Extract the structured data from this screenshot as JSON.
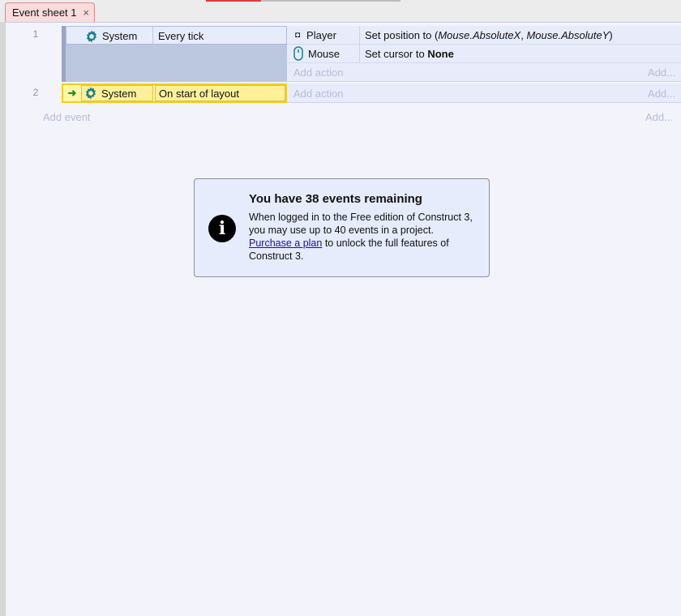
{
  "tabs": [
    {
      "label": "Event sheet 1",
      "close": "×"
    }
  ],
  "events": [
    {
      "number": "1",
      "condition": {
        "object": "System",
        "text": "Every tick"
      },
      "actions": [
        {
          "object": "Player",
          "text_before": "Set position to (",
          "param1": "Mouse.AbsoluteX",
          "sep": ", ",
          "param2": "Mouse.AbsoluteY",
          "text_after": ")"
        },
        {
          "object": "Mouse",
          "text_before": "Set cursor to ",
          "bold": "None"
        }
      ],
      "add_action": "Add action",
      "add_more": "Add..."
    },
    {
      "number": "2",
      "condition": {
        "object": "System",
        "text": "On start of layout"
      },
      "add_action": "Add action",
      "add_more": "Add..."
    }
  ],
  "add_event": "Add event",
  "add_event_more": "Add...",
  "notice": {
    "title": "You have 38 events remaining",
    "body_before": "When logged in to the Free edition of Construct 3, you may use up to 40 events in a project. ",
    "link": "Purchase a plan",
    "body_after": " to unlock the full features of Construct 3.",
    "icon": "info-icon"
  },
  "colors": {
    "selected_event_bg": "#fff7a8",
    "selected_event_border": "#f0cf1f",
    "tab_bg": "#fadcdc",
    "accent_teal": "#1c7f93"
  }
}
